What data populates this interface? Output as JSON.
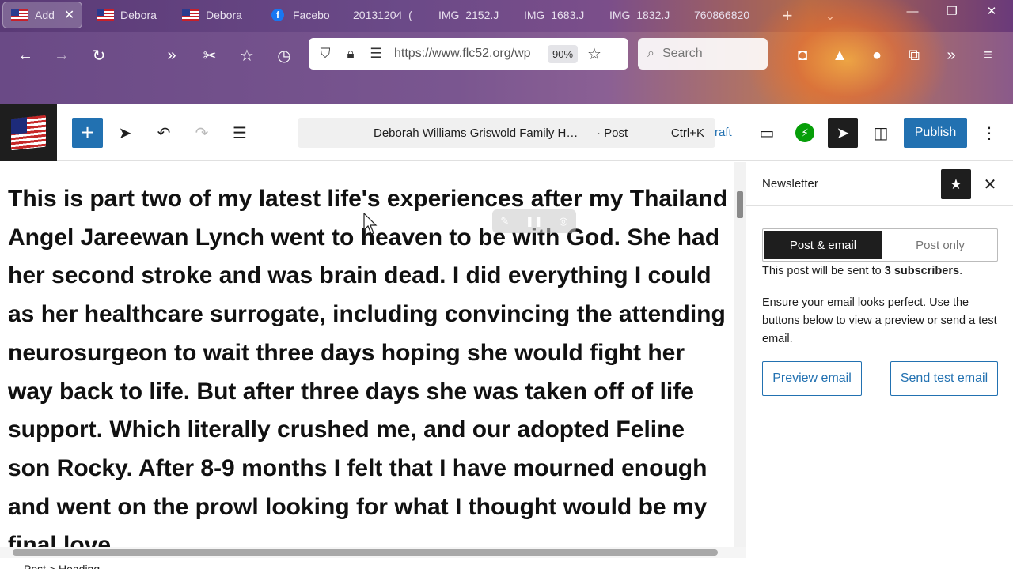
{
  "browser": {
    "tabs": [
      {
        "label": "Add",
        "icon": "us-flag-icon",
        "active": true
      },
      {
        "label": "Debora",
        "icon": "us-flag-icon"
      },
      {
        "label": "Debora",
        "icon": "us-flag-icon"
      },
      {
        "label": "Facebo",
        "icon": "facebook-icon"
      },
      {
        "label": "20131204_(",
        "icon": ""
      },
      {
        "label": "IMG_2152.J",
        "icon": ""
      },
      {
        "label": "IMG_1683.J",
        "icon": ""
      },
      {
        "label": "IMG_1832.J",
        "icon": ""
      },
      {
        "label": "760866820",
        "icon": ""
      }
    ],
    "url": "https://www.flc52.org/wp",
    "zoom": "90%",
    "search_placeholder": "Search"
  },
  "editor": {
    "doc_title": "Deborah Williams Griswold Family H…",
    "doc_type": "· Post",
    "shortcut": "Ctrl+K",
    "draft_label": "raft",
    "publish_label": "Publish"
  },
  "content": {
    "paragraph": "This is part two of my latest life's experiences after my Thailand Angel Jareewan Lynch went to heaven to be with God. She had her second stroke and was brain dead. I did everything I could as her healthcare surrogate, including convincing the attending neurosurgeon to wait three days hoping she would fight her way back to life. But after three days she was taken off of life support. Which literally crushed me, and our adopted Feline son Rocky. After 8-9 months I felt that I have mourned enough and went on the prowl looking for what I thought would be my final love",
    "breadcrumb": "Post > Heading"
  },
  "sidebar": {
    "title": "Newsletter",
    "seg_on": "Post & email",
    "seg_off": "Post only",
    "sent_prefix": "This post will be sent to ",
    "sent_count": "3 subscribers",
    "sent_suffix": ".",
    "description": "Ensure your email looks perfect. Use the buttons below to view a preview or send a test email.",
    "preview_label": "Preview email",
    "send_test_label": "Send test email"
  }
}
